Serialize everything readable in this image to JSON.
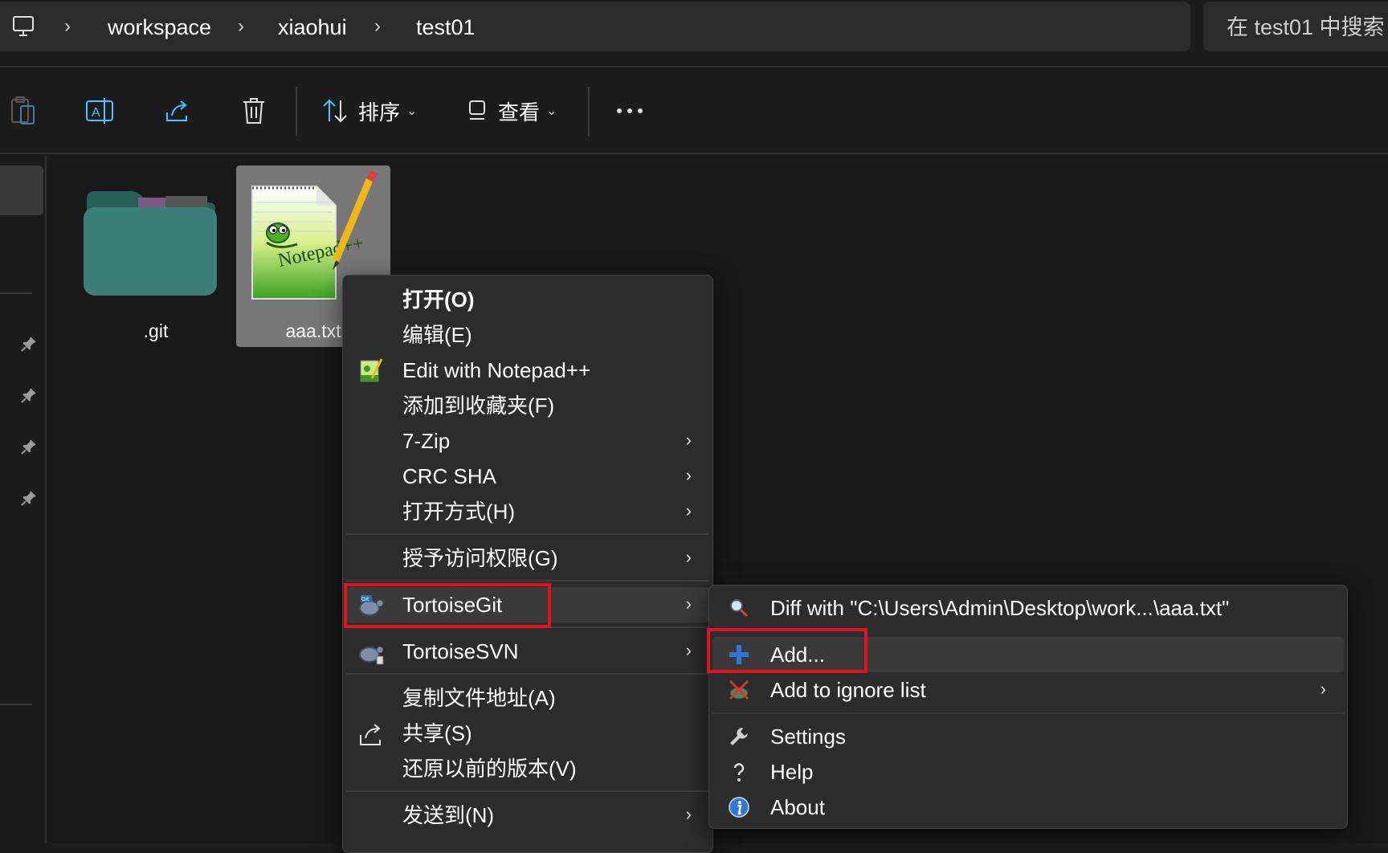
{
  "address_bar": {
    "breadcrumbs": [
      "workspace",
      "xiaohui",
      "test01"
    ],
    "search_placeholder": "在 test01 中搜索"
  },
  "toolbar": {
    "sort_label": "排序",
    "view_label": "查看"
  },
  "files": [
    {
      "name": ".git",
      "type": "folder",
      "icon": "folder-icon"
    },
    {
      "name": "aaa.txt",
      "type": "text",
      "icon": "notepad-plus-plus-icon",
      "selected": true
    }
  ],
  "context_menu": {
    "items": [
      {
        "label": "打开(O)",
        "bold": true
      },
      {
        "label": "编辑(E)"
      },
      {
        "label": "Edit with Notepad++",
        "icon": "notepad-plus-plus-icon"
      },
      {
        "label": "添加到收藏夹(F)"
      },
      {
        "label": "7-Zip",
        "submenu": true
      },
      {
        "label": "CRC SHA",
        "submenu": true
      },
      {
        "label": "打开方式(H)",
        "submenu": true
      },
      {
        "label": "授予访问权限(G)",
        "submenu": true
      },
      {
        "label": "TortoiseGit",
        "submenu": true,
        "icon": "tortoisegit-icon",
        "highlighted": true
      },
      {
        "label": "TortoiseSVN",
        "submenu": true,
        "icon": "tortoisesvn-icon"
      },
      {
        "label": "复制文件地址(A)"
      },
      {
        "label": "共享(S)",
        "icon": "share-icon"
      },
      {
        "label": "还原以前的版本(V)"
      },
      {
        "label": "发送到(N)",
        "submenu": true
      }
    ]
  },
  "tortoisegit_submenu": {
    "items": [
      {
        "label": "Diff with \"C:\\Users\\Admin\\Desktop\\work...\\aaa.txt\"",
        "icon": "diff-magnifier-icon"
      },
      {
        "label": "Add...",
        "icon": "plus-icon",
        "highlighted": true
      },
      {
        "label": "Add to ignore list",
        "icon": "ignore-icon",
        "submenu": true
      },
      {
        "label": "Settings",
        "icon": "wrench-icon"
      },
      {
        "label": "Help",
        "icon": "help-icon"
      },
      {
        "label": "About",
        "icon": "info-icon"
      }
    ]
  },
  "colors": {
    "highlight_border": "#e4121f",
    "accent_blue": "#4cc2ff",
    "folder_teal": "#2f7a72"
  }
}
